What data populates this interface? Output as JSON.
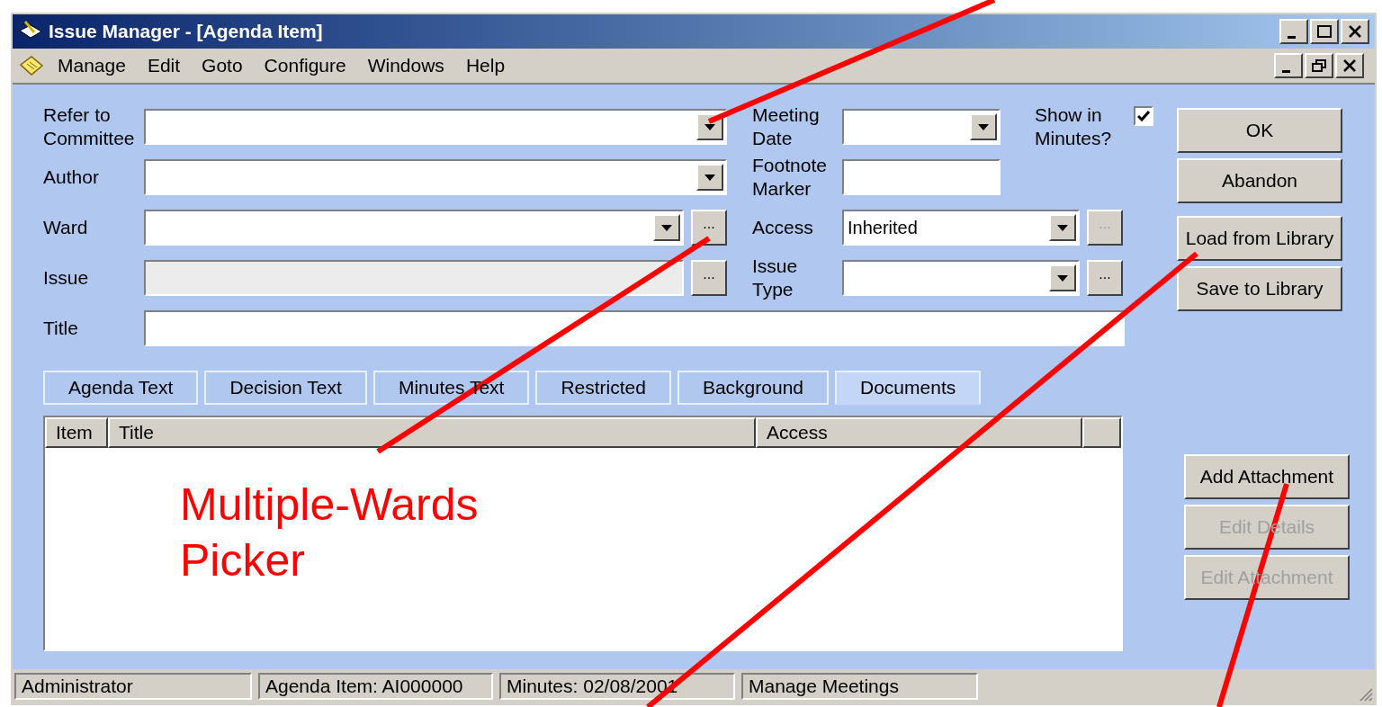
{
  "window": {
    "title": "Issue Manager - [Agenda Item]"
  },
  "menu": [
    "Manage",
    "Edit",
    "Goto",
    "Configure",
    "Windows",
    "Help"
  ],
  "left_fields": [
    {
      "label": "Refer to\nCommittee",
      "kind": "combo",
      "disabled": false
    },
    {
      "label": "Author",
      "kind": "combo",
      "disabled": false
    },
    {
      "label": "Ward",
      "kind": "combo_picker",
      "disabled": false,
      "picker": "..."
    },
    {
      "label": "Issue",
      "kind": "text_picker",
      "disabled": true,
      "picker": "..."
    },
    {
      "label": "Title",
      "kind": "text",
      "disabled": false
    }
  ],
  "right_fields": [
    {
      "label": "Meeting\nDate",
      "kind": "combo"
    },
    {
      "label": "Footnote\nMarker",
      "kind": "text"
    },
    {
      "label": "Access",
      "kind": "combo_picker",
      "value": "Inherited",
      "picker": "...",
      "picker_disabled": true
    },
    {
      "label": "Issue\nType",
      "kind": "combo_picker",
      "picker": "...",
      "picker_disabled": false
    }
  ],
  "show_in_minutes": {
    "label": "Show in\nMinutes?",
    "checked": true
  },
  "top_buttons": [
    {
      "label": "OK",
      "disabled": false
    },
    {
      "label": "Abandon",
      "disabled": false
    },
    {
      "label": "Load from Library",
      "disabled": false
    },
    {
      "label": "Save to Library",
      "disabled": false
    }
  ],
  "tabs": [
    {
      "label": "Agenda Text",
      "selected": false
    },
    {
      "label": "Decision Text",
      "selected": false
    },
    {
      "label": "Minutes Text",
      "selected": false
    },
    {
      "label": "Restricted",
      "selected": false
    },
    {
      "label": "Background",
      "selected": false
    },
    {
      "label": "Documents",
      "selected": true
    }
  ],
  "table": {
    "columns": [
      "Item",
      "Title",
      "Access"
    ]
  },
  "attachment_buttons": [
    {
      "label": "Add Attachment",
      "disabled": false
    },
    {
      "label": "Edit Details",
      "disabled": true
    },
    {
      "label": "Edit Attachment",
      "disabled": true
    }
  ],
  "status_bar": [
    "Administrator",
    "Agenda Item: AI000000",
    "Minutes: 02/08/2001",
    "Manage Meetings"
  ],
  "annotation": {
    "text": "Multiple-Wards Picker"
  }
}
